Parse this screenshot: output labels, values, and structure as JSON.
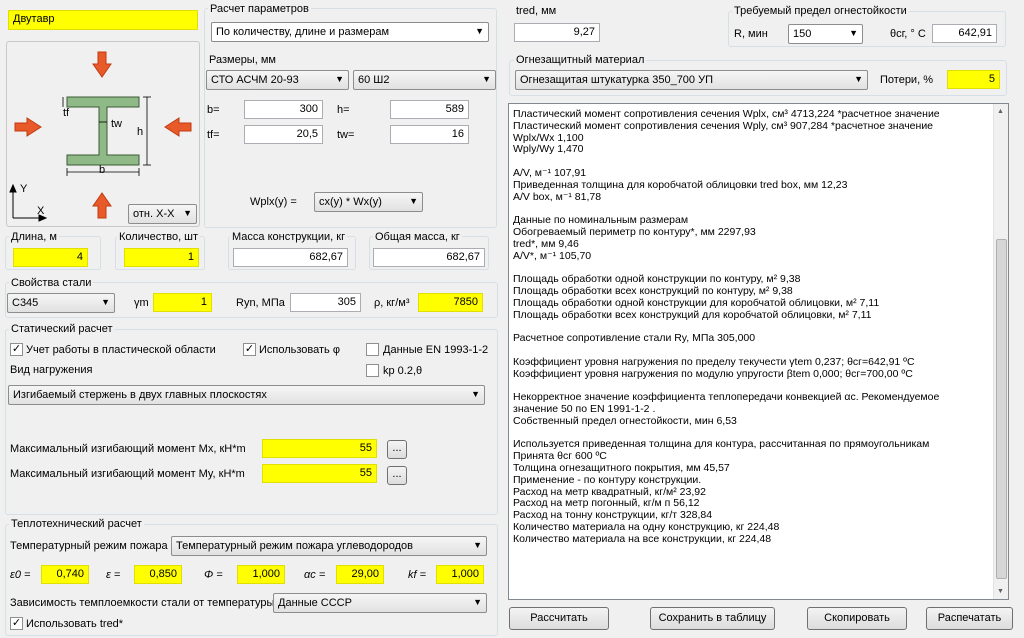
{
  "profile": {
    "type_label": "Двутавр",
    "view_select": "отн. X-X"
  },
  "params": {
    "title": "Расчет параметров",
    "mode": "По количеству, длине и размерам",
    "sizes_title": "Размеры, мм",
    "standard": "СТО АСЧМ 20-93",
    "profile_size": "60 Ш2",
    "b_label": "b=",
    "b": "300",
    "h_label": "h=",
    "h": "589",
    "tf_label": "tf=",
    "tf": "20,5",
    "tw_label": "tw=",
    "tw": "16",
    "wpl_label": "Wplx(y) =",
    "wpl_select": "cx(y) * Wx(y)"
  },
  "tred": {
    "label": "tred, мм",
    "value": "9,27"
  },
  "fire": {
    "title": "Требуемый предел огнестойкости",
    "r_label": "R, мин",
    "r_value": "150",
    "theta_label": "θсг, ° С",
    "theta_value": "642,91"
  },
  "material": {
    "title": "Огнезащитный материал",
    "value": "Огнезащитая штукатурка  350_700 УП",
    "loss_label": "Потери, %",
    "loss_value": "5"
  },
  "geometry": {
    "length_label": "Длина, м",
    "length": "4",
    "qty_label": "Количество, шт",
    "qty": "1",
    "mass_label": "Масса конструкции, кг",
    "mass": "682,67",
    "total_label": "Общая масса, кг",
    "total": "682,67"
  },
  "steel": {
    "title": "Свойства стали",
    "grade": "С345",
    "gm_label": "γm",
    "gm": "1",
    "ryn_label": "Ryn, МПа",
    "ryn": "305",
    "rho_label": "ρ, кг/м³",
    "rho": "7850"
  },
  "static": {
    "title": "Статический расчет",
    "plastic_label": "Учет работы в пластической области",
    "use_phi_label": "Использовать  φ",
    "en_label": "Данные EN 1993-1-2",
    "kp_label": "kp 0.2,θ",
    "load_type_label": "Вид нагружения",
    "load_type": "Изгибаемый стержень в двух главных плоскостях",
    "mx_label": "Максимальный изгибающий момент Mx, кН*m",
    "mx": "55",
    "my_label": "Максимальный изгибающий момент My, кН*m",
    "my": "55",
    "dots": "..."
  },
  "thermal": {
    "title": "Теплотехнический  расчет",
    "mode_label": "Температурный режим пожара",
    "mode": "Температурный режим пожара углеводородов",
    "e0_label": "ε0 =",
    "e0": "0,740",
    "e_label": "ε =",
    "e": "0,850",
    "phi_label": "Φ =",
    "phi": "1,000",
    "ac_label": "αc =",
    "ac": "29,00",
    "kf_label": "kf =",
    "kf": "1,000",
    "heat_label": "Зависимость темплоемкости стали от температуры",
    "heat_source": "Данные СССР",
    "use_tred_label": "Использовать  tred*"
  },
  "results": [
    "Пластический момент сопротивления сечения Wplx, см³  4713,224  *расчетное значение",
    "Пластический момент сопротивления сечения Wply, см³  907,284  *расчетное значение",
    "Wplx/Wx  1,100",
    "Wply/Wy  1,470",
    "",
    "A/V, м⁻¹  107,91",
    "Приведенная толщина для коробчатой облицовки tred box, мм  12,23",
    "A/V box, м⁻¹  81,78",
    "",
    "Данные по номинальным размерам",
    "Обогреваемый периметр по контуру*, мм  2297,93",
    "tred*, мм  9,46",
    "A/V*, м⁻¹  105,70",
    "",
    "Площадь обработки одной конструкции по контуру, м²  9,38",
    "Площадь обработки всех конструкций по контуру, м²  9,38",
    "Площадь обработки одной конструкции для коробчатой облицовки, м²  7,11",
    "Площадь обработки всех конструкций для коробчатой облицовки, м²  7,11",
    "",
    "Расчетное сопротивление стали Ry, МПа  305,000",
    "",
    "Коэффициент уровня нагружения по пределу текучести γtem  0,237;  θсг=642,91 ºС",
    "Коэффициент уровня нагружения по модулю упругости βtem  0,000;  θсг=700,00 ºС",
    "",
    "Некорректное значение  коэффициента теплопередачи конвекцией αс. Рекомендуемое",
    "значение 50 по EN 1991-1-2 .",
    "Собственный предел огнестойкости, мин 6,53",
    "",
    "Используется приведенная толщина для контура, рассчитанная по прямоугольникам",
    "Принята θсг 600 ºС",
    "Толщина огнезащитного покрытия, мм  45,57",
    "Применение -  по контуру конструкции.",
    "Расход на метр квадратный, кг/м²  23,92",
    "Расход на метр погонный, кг/м п  56,12",
    "Расход на тонну конструкции, кг/т  328,84",
    "Количество материала на одну конструкцию, кг  224,48",
    "Количество материала на все конструкции, кг  224,48"
  ],
  "buttons": {
    "calc": "Рассчитать",
    "save": "Сохранить в таблицу",
    "copy": "Скопировать",
    "print": "Распечатать"
  },
  "diagram": {
    "b": "b",
    "h": "h",
    "tf": "tf",
    "tw": "tw",
    "y": "Y",
    "x": "X"
  }
}
